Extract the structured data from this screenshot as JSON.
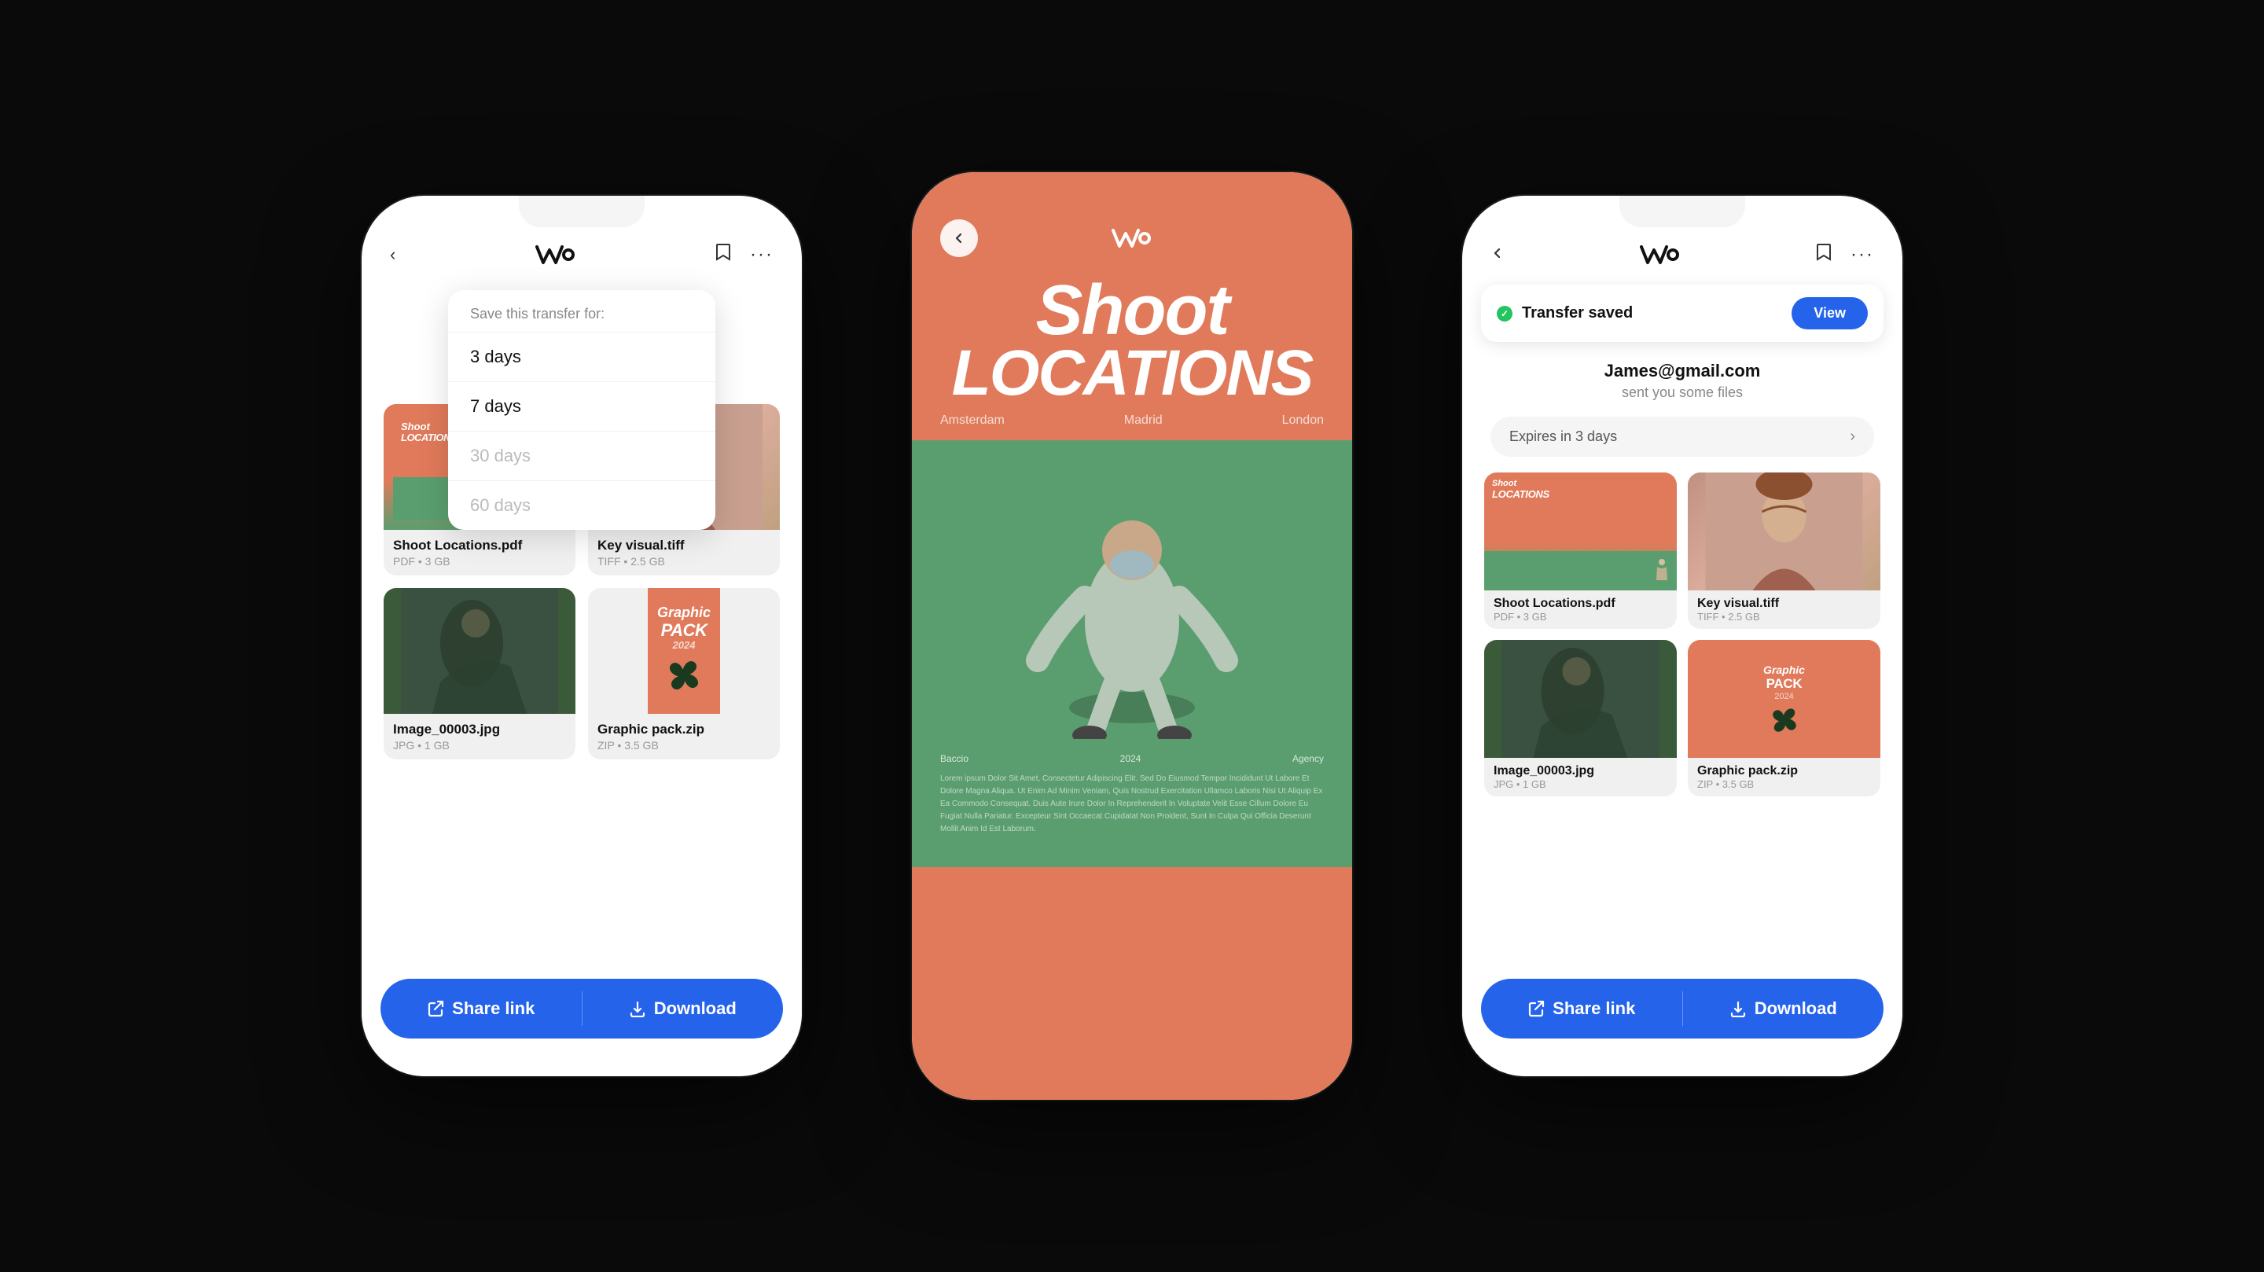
{
  "background": "#0a0a0a",
  "phones": {
    "left": {
      "header": {
        "back_icon": "‹",
        "logo": "we",
        "bookmark_icon": "🔖",
        "more_icon": "•••"
      },
      "dropdown": {
        "title": "Save this transfer for:",
        "options": [
          "3 days",
          "7 days",
          "30 days",
          "60 days"
        ],
        "dimmed": [
          "30 days",
          "60 days"
        ]
      },
      "files": [
        {
          "name": "Shoot Locations.pdf",
          "meta": "PDF • 3 GB",
          "type": "shoot-locations"
        },
        {
          "name": "Key visual.tiff",
          "meta": "TIFF • 2.5 GB",
          "type": "key-visual"
        },
        {
          "name": "Image_00003.jpg",
          "meta": "JPG • 1 GB",
          "type": "dark-image"
        },
        {
          "name": "Graphic pack.zip",
          "meta": "ZIP • 3.5 GB",
          "type": "graphic-pack"
        }
      ],
      "actions": {
        "share_link": "Share link",
        "download": "Download"
      }
    },
    "center": {
      "back_icon": "‹",
      "logo": "we",
      "hero_title_line1": "Shoot",
      "hero_title_line2": "LOCATIONS",
      "cities": [
        "Amsterdam",
        "Madrid",
        "London"
      ],
      "year": "2024",
      "agency_label": "Agency",
      "bacco_label": "Baccio",
      "body_text": "Lorem ipsum Dolor Sit Amet, Consectetur Adipiscing Elit. Sed Do Eiusmod Tempor Incididunt Ut Labore Et Dolore Magna Aliqua. Ut Enim Ad Minim Veniam, Quis Nostrud Exercitation Ullamco Laboris Nisi Ut Aliquip Ex Ea Commodo Consequat. Duis Aute Irure Dolor In Reprehenderit In Voluptate Velit Esse Cillum Dolore Eu Fugiat Nulla Pariatur. Excepteur Sint Occaecat Cupidatat Non Proident, Sunt In Culpa Qui Officia Deserunt Mollit Anim Id Est Laborum."
    },
    "right": {
      "header": {
        "back_icon": "‹",
        "logo": "we",
        "bookmark_icon": "🔖",
        "more_icon": "•••"
      },
      "transfer_saved": {
        "text": "Transfer saved",
        "view_label": "View"
      },
      "sender": {
        "email": "James@gmail.com",
        "subtitle": "sent you some files"
      },
      "expires": "Expires in 3 days",
      "files": [
        {
          "name": "Shoot Locations.pdf",
          "meta": "PDF • 3 GB",
          "type": "shoot-locations"
        },
        {
          "name": "Key visual.tiff",
          "meta": "TIFF • 2.5 GB",
          "type": "key-visual"
        },
        {
          "name": "Image_00003.jpg",
          "meta": "JPG • 1 GB",
          "type": "dark-image"
        },
        {
          "name": "Graphic pack.zip",
          "meta": "ZIP • 3.5 GB",
          "type": "graphic-pack"
        }
      ],
      "actions": {
        "share_link": "Share link",
        "download": "Download"
      }
    }
  }
}
